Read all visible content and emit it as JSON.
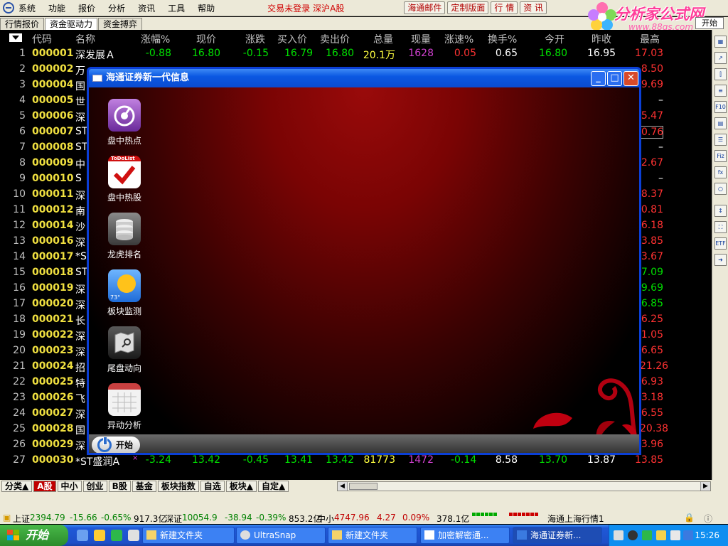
{
  "menubar": {
    "items": [
      "系统",
      "功能",
      "报价",
      "分析",
      "资讯",
      "工具",
      "帮助"
    ],
    "status": "交易未登录",
    "market": "深沪A股",
    "buttons": [
      "海通邮件",
      "定制版面",
      "行  情",
      "资  讯"
    ]
  },
  "brand": {
    "name": "分析家公式网",
    "url": "www.88gs.com",
    "start": "开始",
    "colors": {
      "pink": "#ff3f9a"
    }
  },
  "subtabs": [
    "行情报价",
    "资金驱动力",
    "资金搏弈"
  ],
  "table": {
    "headers": [
      "代码",
      "名称",
      "涨幅%",
      "现价",
      "涨跌",
      "买入价",
      "卖出价",
      "总量",
      "现量",
      "涨速%",
      "换手%",
      "今开",
      "昨收",
      "最高"
    ],
    "first_row": {
      "idx": "1",
      "code": "000001",
      "name": "深发展Ａ",
      "change_pct": "-0.88",
      "price": "16.80",
      "change": "-0.15",
      "bid": "16.79",
      "ask": "16.80",
      "volume": "20.1万",
      "cur_vol": "1628",
      "speed": "0.05",
      "turnover": "0.65",
      "open": "16.80",
      "prev_close": "16.95",
      "high": "17.03"
    },
    "rows": [
      {
        "idx": "2",
        "code": "000002",
        "name": "万",
        "high": "8.50",
        "color": "red"
      },
      {
        "idx": "3",
        "code": "000004",
        "name": "国",
        "high": "9.69",
        "color": "red"
      },
      {
        "idx": "4",
        "code": "000005",
        "name": "世",
        "high": "–",
        "color": "white"
      },
      {
        "idx": "5",
        "code": "000006",
        "name": "深",
        "high": "5.47",
        "color": "red"
      },
      {
        "idx": "6",
        "code": "000007",
        "name": "ST",
        "high": "0.76",
        "color": "red"
      },
      {
        "idx": "7",
        "code": "000008",
        "name": "ST",
        "high": "–",
        "color": "white"
      },
      {
        "idx": "8",
        "code": "000009",
        "name": "中",
        "high": "2.67",
        "color": "red"
      },
      {
        "idx": "9",
        "code": "000010",
        "name": "S",
        "high": "–",
        "color": "white"
      },
      {
        "idx": "10",
        "code": "000011",
        "name": "深",
        "high": "8.37",
        "color": "red"
      },
      {
        "idx": "11",
        "code": "000012",
        "name": "南",
        "high": "0.81",
        "color": "red"
      },
      {
        "idx": "12",
        "code": "000014",
        "name": "沙",
        "high": "6.18",
        "color": "red"
      },
      {
        "idx": "13",
        "code": "000016",
        "name": "深",
        "high": "3.85",
        "color": "red"
      },
      {
        "idx": "14",
        "code": "000017",
        "name": "*S",
        "high": "3.67",
        "color": "red"
      },
      {
        "idx": "15",
        "code": "000018",
        "name": "ST",
        "high": "7.09",
        "color": "green"
      },
      {
        "idx": "16",
        "code": "000019",
        "name": "深",
        "high": "9.69",
        "color": "green"
      },
      {
        "idx": "17",
        "code": "000020",
        "name": "深",
        "high": "6.85",
        "color": "green"
      },
      {
        "idx": "18",
        "code": "000021",
        "name": "长",
        "high": "6.25",
        "color": "red"
      },
      {
        "idx": "19",
        "code": "000022",
        "name": "深",
        "high": "1.05",
        "color": "red"
      },
      {
        "idx": "20",
        "code": "000023",
        "name": "深",
        "high": "6.65",
        "color": "red"
      },
      {
        "idx": "21",
        "code": "000024",
        "name": "招",
        "high": "21.26",
        "color": "red"
      },
      {
        "idx": "22",
        "code": "000025",
        "name": "特",
        "high": "6.93",
        "color": "red"
      },
      {
        "idx": "23",
        "code": "000026",
        "name": "飞",
        "high": "3.18",
        "color": "red"
      },
      {
        "idx": "24",
        "code": "000027",
        "name": "深",
        "high": "6.55",
        "color": "red"
      },
      {
        "idx": "25",
        "code": "000028",
        "name": "国",
        "high": "20.38",
        "color": "red"
      },
      {
        "idx": "26",
        "code": "000029",
        "name": "深",
        "high": "3.96",
        "color": "red"
      }
    ],
    "last_row": {
      "idx": "27",
      "code": "000030",
      "name": "*ST盛润A",
      "mark": "×",
      "change_pct": "-3.24",
      "price": "13.42",
      "change": "-0.45",
      "bid": "13.41",
      "ask": "13.42",
      "volume": "81773",
      "cur_vol": "1472",
      "speed": "-0.14",
      "turnover": "8.58",
      "open": "13.70",
      "prev_close": "13.87",
      "high": "13.85"
    }
  },
  "bottom_tabs": [
    "分类▲",
    "A股",
    "中小",
    "创业",
    "B股",
    "基金",
    "板块指数",
    "自选",
    "板块▲",
    "自定▲"
  ],
  "index_bar": {
    "sh_label": "上证",
    "sh_value": "2394.79",
    "sh_change": "-15.66",
    "sh_pct": "-0.65%",
    "sh_amount": "917.3亿",
    "sz_label": "深证",
    "sz_value": "10054.9",
    "sz_change": "-38.94",
    "sz_pct": "-0.39%",
    "sz_amount": "853.2亿",
    "sme_label": "中小",
    "sme_value": "4747.96",
    "sme_change": "4.27",
    "sme_pct": "0.09%",
    "sme_amount": "378.1亿",
    "marquee": "海通上海行情1"
  },
  "dialog": {
    "title": "海通证券新一代信息",
    "apps": [
      {
        "label": "盘中热点",
        "icon": "radar-icon"
      },
      {
        "label": "盘中热股",
        "icon": "todolist-icon"
      },
      {
        "label": "龙虎排名",
        "icon": "database-icon"
      },
      {
        "label": "板块监测",
        "icon": "weather-icon"
      },
      {
        "label": "尾盘动向",
        "icon": "map-icon"
      },
      {
        "label": "异动分析",
        "icon": "calendar-icon"
      }
    ],
    "start_label": "开始",
    "icon_badge_todo": "ToDoList",
    "icon_badge_temp": "73°"
  },
  "taskbar": {
    "start": "开始",
    "tasks": [
      "新建文件夹",
      "UltraSnap",
      "新建文件夹",
      "加密解密通...",
      "海通证券新..."
    ],
    "clock": "15:26"
  }
}
